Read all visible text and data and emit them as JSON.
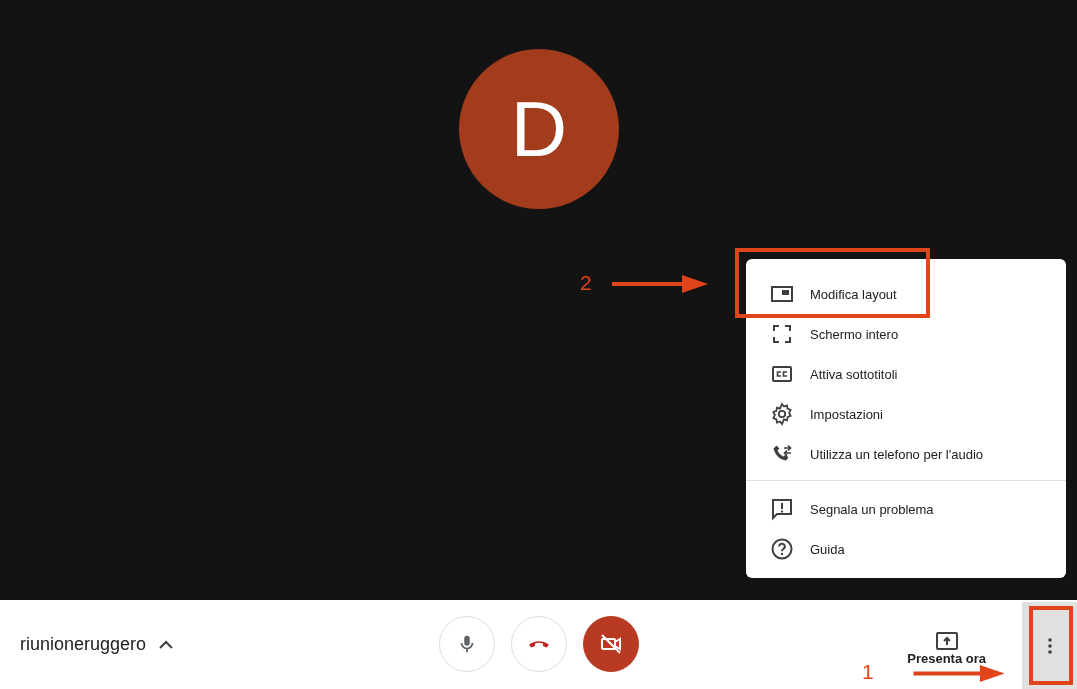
{
  "avatar": {
    "initial": "D"
  },
  "menu": {
    "sections": [
      [
        {
          "kind": "layout",
          "label": "Modifica layout"
        },
        {
          "kind": "fullscreen",
          "label": "Schermo intero"
        },
        {
          "kind": "captions",
          "label": "Attiva sottotitoli"
        },
        {
          "kind": "settings",
          "label": "Impostazioni"
        },
        {
          "kind": "phone",
          "label": "Utilizza un telefono per l'audio"
        }
      ],
      [
        {
          "kind": "report",
          "label": "Segnala un problema"
        },
        {
          "kind": "help",
          "label": "Guida"
        }
      ]
    ]
  },
  "bottom_bar": {
    "meeting_name": "riunioneruggero",
    "details_expanded": false,
    "controls": [
      {
        "kind": "mic",
        "on": true
      },
      {
        "kind": "hangup"
      },
      {
        "kind": "camera",
        "on": false
      }
    ],
    "present": {
      "label": "Presenta ora"
    }
  },
  "annotations": [
    {
      "number": "2",
      "kind": "menu"
    },
    {
      "number": "1",
      "kind": "more"
    }
  ]
}
